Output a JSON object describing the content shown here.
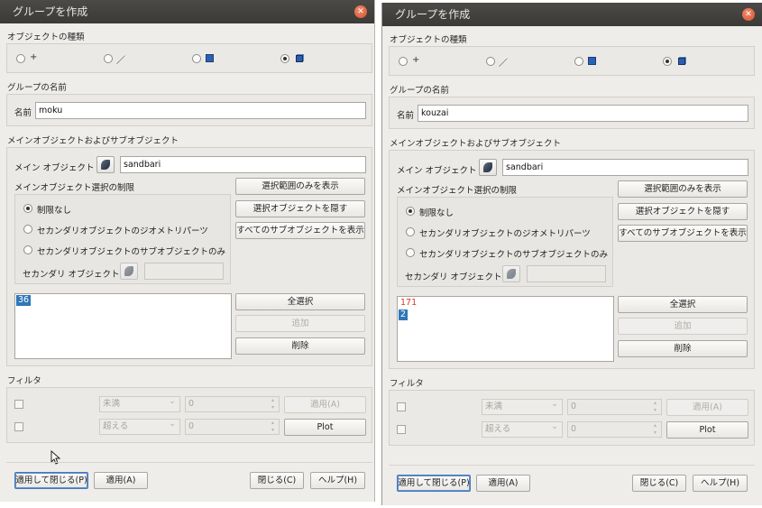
{
  "dialogs": [
    {
      "title": "グループを作成",
      "object_type": {
        "section": "オブジェクトの種類",
        "options": [
          {
            "symbol": "+",
            "icon": "point-icon",
            "selected": false
          },
          {
            "symbol": "／",
            "icon": "line-icon",
            "selected": false
          },
          {
            "symbol": "",
            "icon": "surface-icon",
            "selected": false
          },
          {
            "symbol": "",
            "icon": "solid-icon",
            "selected": true
          }
        ]
      },
      "group_name": {
        "section": "グループの名前",
        "label": "名前",
        "value": "moku"
      },
      "main_sub": {
        "section": "メインオブジェクトおよびサブオブジェクト",
        "main_label": "メイン オブジェクト",
        "main_value": "sandbari",
        "restriction_title": "メインオブジェクト選択の制限",
        "restrictions": [
          {
            "label": "制限なし",
            "selected": true
          },
          {
            "label": "セカンダリオブジェクトのジオメトリパーツ",
            "selected": false
          },
          {
            "label": "セカンダリオブジェクトのサブオブジェクトのみ",
            "selected": false
          }
        ],
        "secondary_label": "セカンダリ オブジェクト",
        "secondary_value": "",
        "btn_show_only": "選択範囲のみを表示",
        "btn_hide_selected": "選択オブジェクトを隠す",
        "btn_show_all": "すべてのサブオブジェクトを表示",
        "list_items": [
          {
            "text": "36",
            "selected": true,
            "red": false
          }
        ],
        "btn_select_all": "全選択",
        "btn_add": "追加",
        "btn_remove": "削除"
      },
      "filter": {
        "section": "フィルタ",
        "rows": [
          {
            "combo": "未満",
            "value": "0",
            "button": "適用(A)",
            "enabled": false
          },
          {
            "combo": "超える",
            "value": "0",
            "button": "Plot",
            "enabled": true
          }
        ]
      },
      "footer": {
        "apply_close": "適用して閉じる(P)",
        "apply": "適用(A)",
        "close": "閉じる(C)",
        "help": "ヘルプ(H)"
      }
    },
    {
      "title": "グループを作成",
      "object_type": {
        "section": "オブジェクトの種類",
        "options": [
          {
            "symbol": "+",
            "icon": "point-icon",
            "selected": false
          },
          {
            "symbol": "／",
            "icon": "line-icon",
            "selected": false
          },
          {
            "symbol": "",
            "icon": "surface-icon",
            "selected": false
          },
          {
            "symbol": "",
            "icon": "solid-icon",
            "selected": true
          }
        ]
      },
      "group_name": {
        "section": "グループの名前",
        "label": "名前",
        "value": "kouzai"
      },
      "main_sub": {
        "section": "メインオブジェクトおよびサブオブジェクト",
        "main_label": "メイン オブジェクト",
        "main_value": "sandbari",
        "restriction_title": "メインオブジェクト選択の制限",
        "restrictions": [
          {
            "label": "制限なし",
            "selected": true
          },
          {
            "label": "セカンダリオブジェクトのジオメトリパーツ",
            "selected": false
          },
          {
            "label": "セカンダリオブジェクトのサブオブジェクトのみ",
            "selected": false
          }
        ],
        "secondary_label": "セカンダリ オブジェクト",
        "secondary_value": "",
        "btn_show_only": "選択範囲のみを表示",
        "btn_hide_selected": "選択オブジェクトを隠す",
        "btn_show_all": "すべてのサブオブジェクトを表示",
        "list_items": [
          {
            "text": "171",
            "selected": false,
            "red": true
          },
          {
            "text": "2",
            "selected": true,
            "red": false
          }
        ],
        "btn_select_all": "全選択",
        "btn_add": "追加",
        "btn_remove": "削除"
      },
      "filter": {
        "section": "フィルタ",
        "rows": [
          {
            "combo": "未満",
            "value": "0",
            "button": "適用(A)",
            "enabled": false
          },
          {
            "combo": "超える",
            "value": "0",
            "button": "Plot",
            "enabled": true
          }
        ]
      },
      "footer": {
        "apply_close": "適用して閉じる(P)",
        "apply": "適用(A)",
        "close": "閉じる(C)",
        "help": "ヘルプ(H)"
      }
    }
  ]
}
